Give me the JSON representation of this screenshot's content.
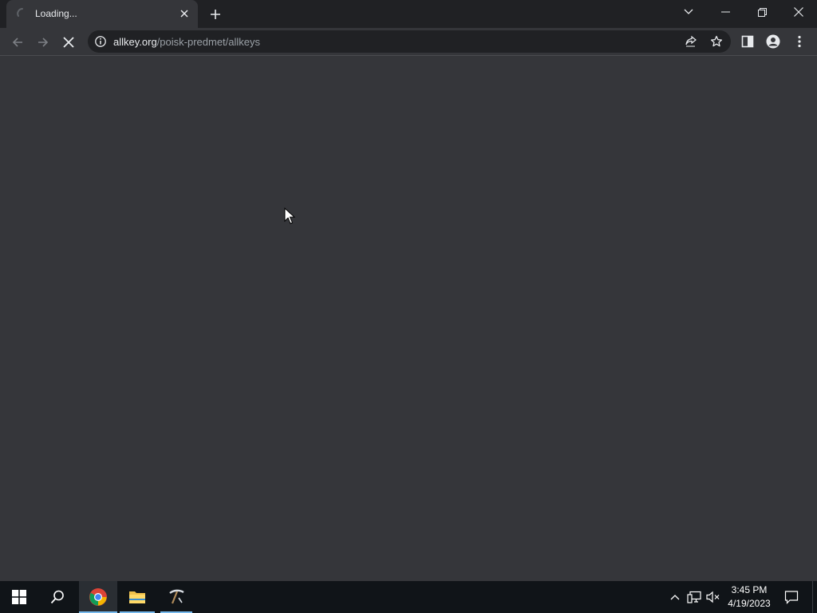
{
  "browser": {
    "tab": {
      "title": "Loading...",
      "state": "loading"
    },
    "address_bar": {
      "host": "allkey.org",
      "path": "/poisk-predmet/allkeys"
    },
    "colors": {
      "frame": "#202124",
      "toolbar": "#35363a",
      "omnibox": "#202124",
      "page_background": "#35363a",
      "text": "#e8eaed",
      "text_muted": "#9aa0a6"
    }
  },
  "icons": {
    "tab_spinner": "spinner-icon",
    "tab_close": "close-icon",
    "new_tab": "plus-icon",
    "tab_search": "chevron-down-icon",
    "minimize": "minimize-icon",
    "restore": "restore-icon",
    "close_window": "close-icon",
    "back": "arrow-left-icon",
    "forward": "arrow-right-icon",
    "stop": "stop-icon",
    "site_info": "info-icon",
    "share": "share-icon",
    "bookmark": "star-icon",
    "side_panel": "side-panel-icon",
    "profile": "profile-icon",
    "menu": "kebab-menu-icon"
  },
  "taskbar": {
    "start": "windows-logo-icon",
    "search": "search-icon",
    "apps": [
      {
        "name": "Google Chrome",
        "icon": "chrome-icon",
        "active": true
      },
      {
        "name": "File Explorer",
        "icon": "folder-icon",
        "active": true
      },
      {
        "name": "Pinned App",
        "icon": "pickaxe-icon",
        "active": true
      }
    ],
    "tray": {
      "chevron": "chevron-up-icon",
      "network": "network-icon",
      "volume": "volume-muted-icon"
    },
    "clock": {
      "time": "3:45 PM",
      "date": "4/19/2023"
    },
    "notifications": "notification-icon",
    "accent": "#76b9ed"
  }
}
